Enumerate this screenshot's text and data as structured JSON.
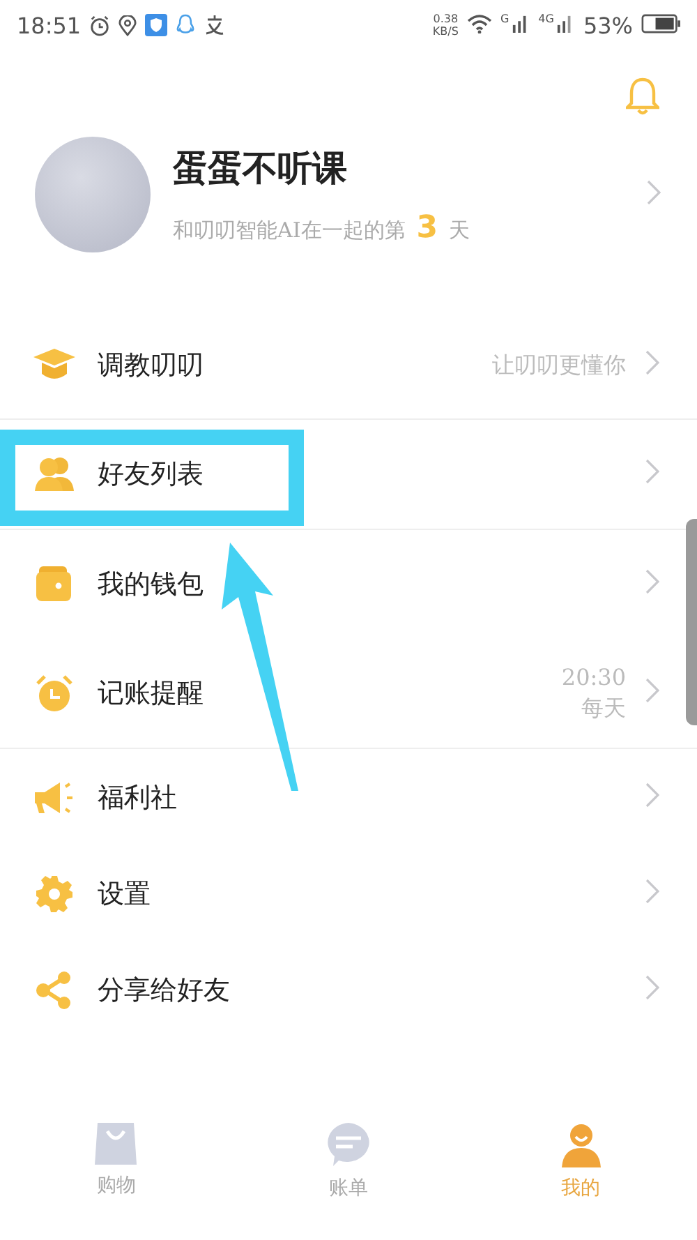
{
  "status_bar": {
    "time": "18:51",
    "speed": "0.38",
    "speed_unit": "KB/S",
    "sim1": "G",
    "sim2": "4G",
    "battery": "53%"
  },
  "profile": {
    "name": "蛋蛋不听课",
    "days_prefix": "和叨叨智能AI在一起的第",
    "days": "3",
    "days_suffix": "天"
  },
  "menu_groups": [
    {
      "items": [
        {
          "kind": "cap",
          "label": "调教叨叨",
          "note": "让叨叨更懂你"
        }
      ]
    },
    {
      "items": [
        {
          "kind": "friends",
          "label": "好友列表"
        }
      ]
    },
    {
      "items": [
        {
          "kind": "wallet",
          "label": "我的钱包"
        },
        {
          "kind": "alarm",
          "label": "记账提醒",
          "note": "20:30",
          "note2": "每天"
        }
      ]
    },
    {
      "items": [
        {
          "kind": "megaphone",
          "label": "福利社"
        },
        {
          "kind": "gear",
          "label": "设置"
        },
        {
          "kind": "share",
          "label": "分享给好友"
        }
      ]
    }
  ],
  "bottom_nav": [
    {
      "kind": "bag",
      "label": "购物",
      "selected": false
    },
    {
      "kind": "chat",
      "label": "账单",
      "selected": false
    },
    {
      "kind": "person",
      "label": "我的",
      "selected": true
    }
  ]
}
